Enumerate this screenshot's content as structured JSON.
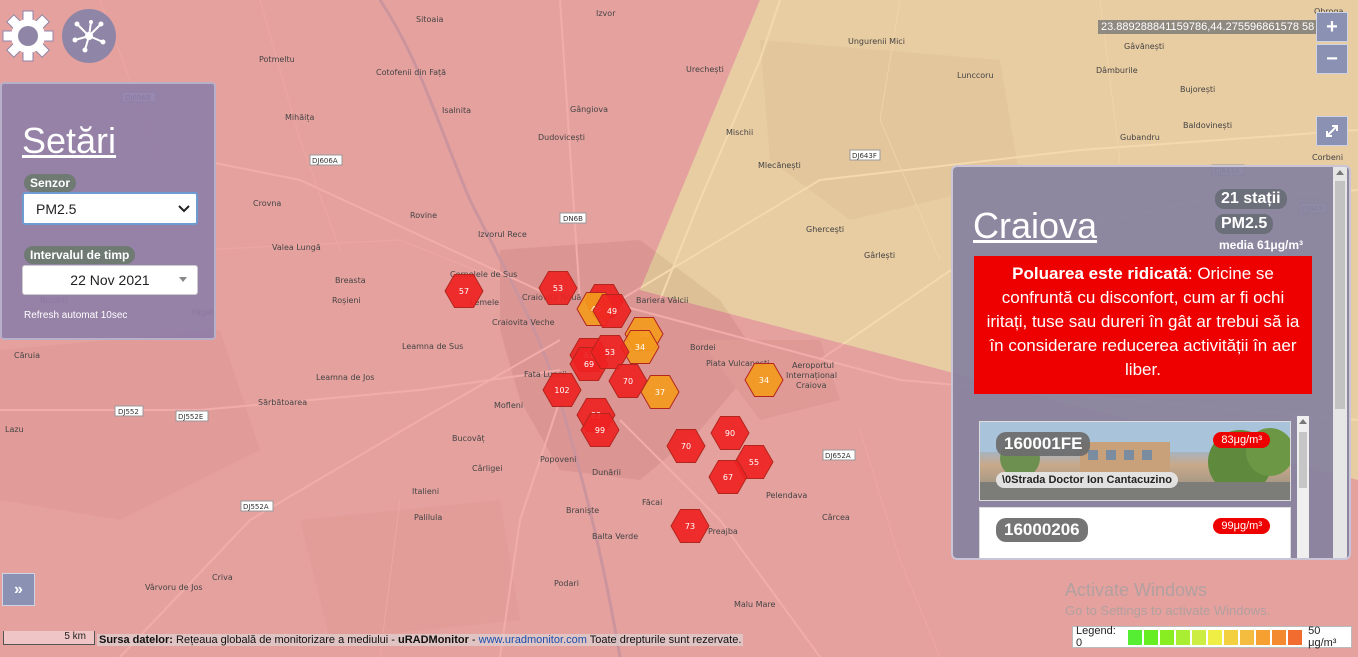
{
  "controls": {
    "settings_icon": "gear-icon",
    "network_icon": "network-icon",
    "zoom_in": "+",
    "zoom_out": "−",
    "fullscreen_icon": "expand-icon",
    "expand_panel": "»"
  },
  "coordinates": "23.889288841159786,44.275596861578 58",
  "settings": {
    "title": "Setări",
    "sensor_label": "Senzor",
    "sensor_value": "PM2.5",
    "interval_label": "Intervalul de timp",
    "date_value": "22 Nov 2021",
    "refresh_text": "Refresh automat 10sec"
  },
  "info": {
    "city": "Craiova",
    "stations": "21 stații",
    "sensor": "PM2.5",
    "average": "media 61μg/m³",
    "alert_bold": "Poluarea este ridicată",
    "alert_text": ": Oricine se confruntă cu disconfort, cum ar fi ochi iritați, tuse sau dureri în gât ar trebui să ia în considerare reducerea activității în aer liber.",
    "stations_list": [
      {
        "id": "160001FE",
        "value": "83μg/m³",
        "address": "\\0Strada Doctor Ion Cantacuzino"
      },
      {
        "id": "16000206",
        "value": "99μg/m³"
      }
    ]
  },
  "map": {
    "place_labels": [
      "Potmeltu",
      "Mihăița",
      "Cotofenii din Față",
      "Isalnita",
      "Izvor",
      "Sitoaia",
      "Urechești",
      "Dudovicești",
      "Gângiova",
      "Coşovenii de Sus",
      "Crovna",
      "Rovine",
      "Izvorul Rece",
      "Valea Lungă",
      "Breasta",
      "Roșieni",
      "Bucinți",
      "Mischii",
      "Mlecănești",
      "Gherceşti",
      "Gârlești",
      "Ungurenii Mici",
      "Lunccoru",
      "Dâmburile",
      "Gubandru",
      "Baldovinești",
      "Corbeni",
      "Cernelele de Sus",
      "Lerneie",
      "Craiovița Nouă",
      "Craiovita Veche",
      "Bariera Vâlcii",
      "Bordei",
      "Fata Luncii",
      "Lunca Jiului",
      "Leamna de Sus",
      "Leamna de Jos",
      "Sărbătoarea",
      "Mofleni",
      "Popoveni",
      "Dunării",
      "Bucovăț",
      "Cârligei",
      "Italieni",
      "Palilula",
      "Braniște",
      "Făcai",
      "Balta Verde",
      "Preajba",
      "Pelendava",
      "Cârcea",
      "Podari",
      "Malu Mare",
      "Craiova",
      "Cârcia",
      "Obroga",
      "Gâvănești",
      "Bujorești",
      "Lazu",
      "Vârvoru de Jos",
      "Criva",
      "Ghercesti",
      "Aeroportul Internațional Craiova",
      "Făget",
      "Cârcea"
    ],
    "road_badges": [
      "DJ606B",
      "DJ606A",
      "DN6B",
      "DJ643F",
      "DJ643",
      "DJ643A",
      "DJ552",
      "DJ552E",
      "DJ552A",
      "DJ652A"
    ],
    "markers": [
      {
        "value": "57",
        "color": "#ee2222"
      },
      {
        "value": "53",
        "color": "#ee2222"
      },
      {
        "value": "50",
        "color": "#ee2222"
      },
      {
        "value": "40",
        "color": "#f39a1d"
      },
      {
        "value": "49",
        "color": "#ee2222"
      },
      {
        "value": "38",
        "color": "#f39a1d"
      },
      {
        "value": "34",
        "color": "#f39a1d"
      },
      {
        "value": "61",
        "color": "#ee2222"
      },
      {
        "value": "69",
        "color": "#ee2222"
      },
      {
        "value": "53",
        "color": "#ee2222"
      },
      {
        "value": "70",
        "color": "#ee2222"
      },
      {
        "value": "37",
        "color": "#f39a1d"
      },
      {
        "value": "102",
        "color": "#ee2222"
      },
      {
        "value": "83",
        "color": "#ee2222"
      },
      {
        "value": "99",
        "color": "#ee2222"
      },
      {
        "value": "70",
        "color": "#ee2222"
      },
      {
        "value": "90",
        "color": "#ee2222"
      },
      {
        "value": "55",
        "color": "#ee2222"
      },
      {
        "value": "67",
        "color": "#ee2222"
      },
      {
        "value": "73",
        "color": "#ee2222"
      },
      {
        "value": "34",
        "color": "#f39a1d"
      }
    ]
  },
  "footer": {
    "scale": "5 km",
    "source_label": "Sursa datelor:",
    "source_text": " Rețeaua globală de monitorizare a mediului - ",
    "source_brand": "uRADMonitor",
    "source_sep": " - ",
    "source_link": "www.uradmonitor.com",
    "source_rights": " Toate drepturile sunt rezervate.",
    "watermark_title": "Activate Windows",
    "watermark_sub": "Go to Settings to activate Windows."
  },
  "legend": {
    "label": "Legend: 0",
    "max": "50 μg/m³",
    "colors": [
      "#55ee33",
      "#66ee22",
      "#88ee22",
      "#aaee33",
      "#ccee44",
      "#eeee44",
      "#f2d040",
      "#f4bd40",
      "#f5a030",
      "#f48a30",
      "#f26c30"
    ]
  }
}
